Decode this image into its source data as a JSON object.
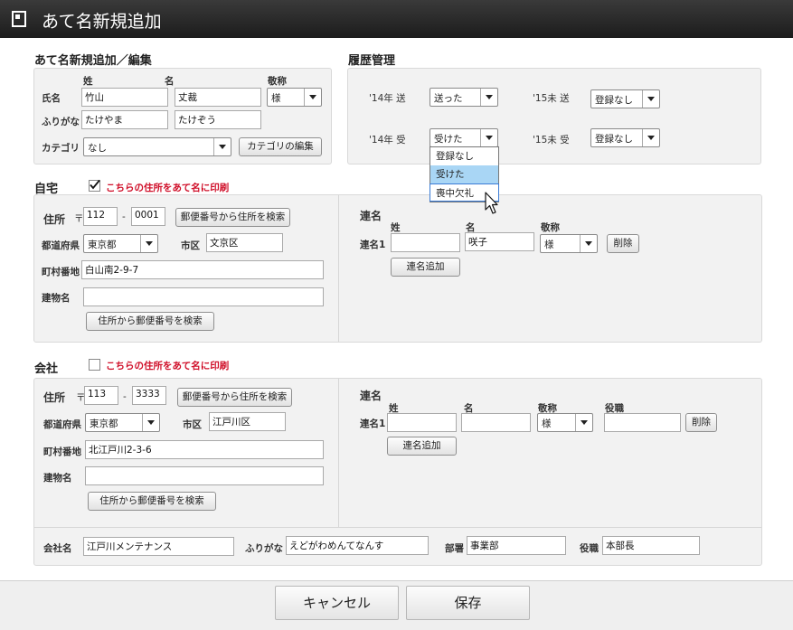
{
  "window": {
    "title": "あて名新規追加"
  },
  "edit": {
    "heading": "あて名新規追加／編集",
    "col_sei": "姓",
    "col_mei": "名",
    "col_keisho": "敬称",
    "name_label": "氏名",
    "sei": "竹山",
    "mei": "丈裁",
    "keisho": "様",
    "furigana_label": "ふりがな",
    "sei_kana": "たけやま",
    "mei_kana": "たけぞう",
    "category_label": "カテゴリ",
    "category": "なし",
    "category_edit_btn": "カテゴリの編集"
  },
  "history": {
    "heading": "履歴管理",
    "r1_label": "'14年 送",
    "r1_value": "送った",
    "r1b_label": "'15未 送",
    "r1b_value": "登録なし",
    "r2_label": "'14年 受",
    "r2_value": "受けた",
    "r2b_label": "'15未 受",
    "r2b_value": "登録なし",
    "dropdown_options": [
      "登録なし",
      "受けた",
      "喪中欠礼"
    ]
  },
  "home": {
    "heading": "自宅",
    "print_label": "こちらの住所をあて名に印刷",
    "print_checked": true,
    "addr_label": "住所",
    "postal_mark": "〒",
    "zip1": "112",
    "dash": "-",
    "zip2": "0001",
    "zip_search_btn": "郵便番号から住所を検索",
    "pref_label": "都道府県",
    "pref": "東京都",
    "city_label": "市区",
    "city": "文京区",
    "street_label": "町村番地",
    "street": "白山南2-9-7",
    "building_label": "建物名",
    "building": "",
    "addr_search_btn": "住所から郵便番号を検索",
    "joint_heading": "連名",
    "col_sei": "姓",
    "col_mei": "名",
    "col_keisho": "敬称",
    "joint_label": "連名1",
    "joint_sei": "",
    "joint_mei": "咲子",
    "joint_keisho": "様",
    "delete_btn": "削除",
    "add_joint_btn": "連名追加"
  },
  "company": {
    "heading": "会社",
    "print_label": "こちらの住所をあて名に印刷",
    "print_checked": false,
    "addr_label": "住所",
    "postal_mark": "〒",
    "zip1": "113",
    "dash": "-",
    "zip2": "3333",
    "zip_search_btn": "郵便番号から住所を検索",
    "pref_label": "都道府県",
    "pref": "東京都",
    "city_label": "市区",
    "city": "江戸川区",
    "street_label": "町村番地",
    "street": "北江戸川2-3-6",
    "building_label": "建物名",
    "building": "",
    "addr_search_btn": "住所から郵便番号を検索",
    "joint_heading": "連名",
    "col_sei": "姓",
    "col_mei": "名",
    "col_keisho": "敬称",
    "col_yakushoku": "役職",
    "joint_label": "連名1",
    "joint_sei": "",
    "joint_mei": "",
    "joint_keisho": "様",
    "joint_yakushoku": "",
    "delete_btn": "削除",
    "add_joint_btn": "連名追加",
    "company_name_label": "会社名",
    "company_name": "江戸川メンテナンス",
    "furigana_label": "ふりがな",
    "company_kana": "えどがわめんてなんす",
    "dept_label": "部署",
    "dept": "事業部",
    "title_label": "役職",
    "title": "本部長"
  },
  "footer": {
    "cancel": "キャンセル",
    "save": "保存"
  }
}
